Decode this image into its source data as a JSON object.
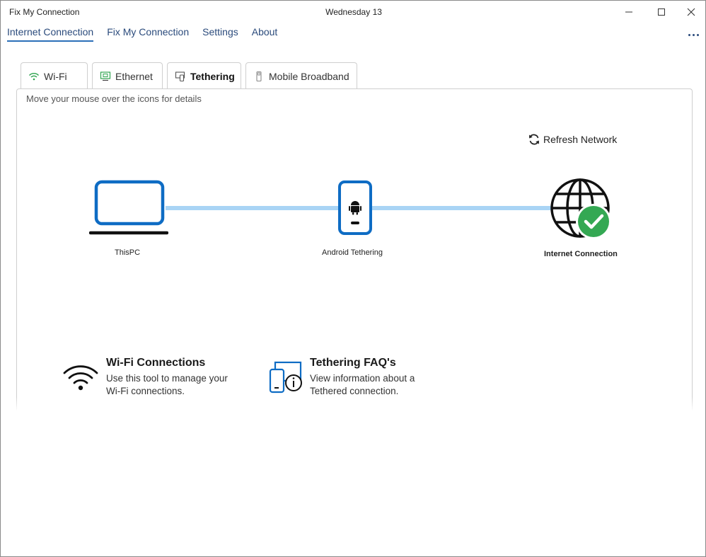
{
  "window": {
    "title": "Fix My Connection",
    "date": "Wednesday 13"
  },
  "nav": {
    "items": [
      {
        "label": "Internet Connection",
        "active": true
      },
      {
        "label": "Fix My Connection",
        "active": false
      },
      {
        "label": "Settings",
        "active": false
      },
      {
        "label": "About",
        "active": false
      }
    ]
  },
  "tabs": [
    {
      "label": "Wi-Fi",
      "icon": "wifi-icon",
      "active": false
    },
    {
      "label": "Ethernet",
      "icon": "ethernet-icon",
      "active": false
    },
    {
      "label": "Tethering",
      "icon": "tethering-icon",
      "active": true
    },
    {
      "label": "Mobile Broadband",
      "icon": "mobile-broadband-icon",
      "active": false
    }
  ],
  "panel": {
    "hint": "Move your mouse over the icons for details",
    "refresh_label": "Refresh Network",
    "nodes": {
      "pc": "ThisPC",
      "device": "Android Tethering",
      "internet": "Internet Connection"
    }
  },
  "tools": {
    "wifi": {
      "title": "Wi-Fi Connections",
      "desc_line1": "Use this tool to manage your",
      "desc_line2": "Wi-Fi connections."
    },
    "faq": {
      "title": "Tethering FAQ's",
      "desc_line1": "View information about a",
      "desc_line2": "Tethered connection."
    }
  },
  "colors": {
    "accent": "#0e6cc4",
    "link": "#2b4b7c",
    "line": "#a9d4f5",
    "success": "#34a853"
  }
}
